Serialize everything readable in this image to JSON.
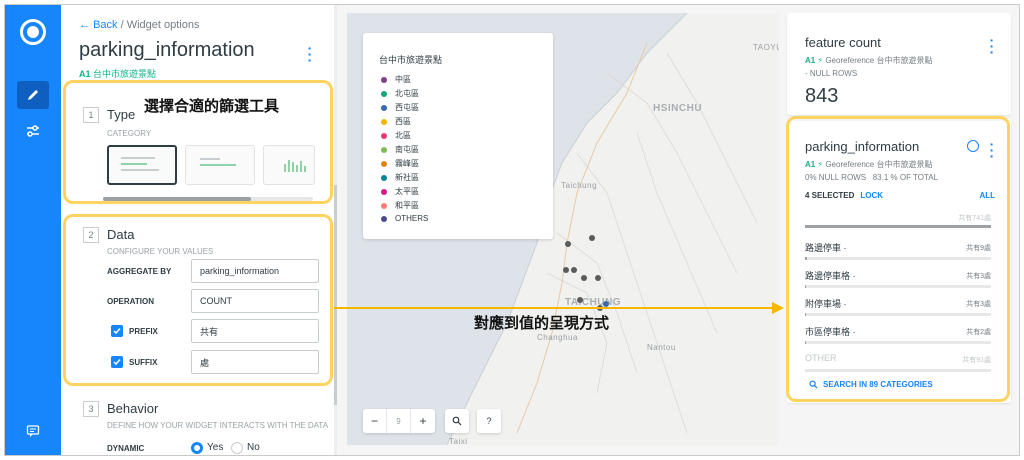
{
  "rail": {
    "logo": "logo-icon",
    "items": [
      "pencil-icon",
      "sliders-icon"
    ],
    "bottom": "chat-icon"
  },
  "editor": {
    "back_label": "Back",
    "breadcrumb_current": "/ Widget options",
    "title": "parking_information",
    "layer_tag": "A1",
    "layer_name": "台中市旅遊景點",
    "type": {
      "num": "1",
      "title": "Type",
      "hint": "CATEGORY"
    },
    "data": {
      "num": "2",
      "title": "Data",
      "hint": "CONFIGURE YOUR VALUES",
      "aggregate_label": "AGGREGATE BY",
      "aggregate_value": "parking_information",
      "operation_label": "OPERATION",
      "operation_value": "COUNT",
      "prefix_label": "PREFIX",
      "prefix_value": "共有",
      "suffix_label": "SUFFIX",
      "suffix_value": "處"
    },
    "behavior": {
      "num": "3",
      "title": "Behavior",
      "hint": "DEFINE HOW YOUR WIDGET INTERACTS WITH THE DATA",
      "dynamic_label": "DYNAMIC",
      "yes_label": "Yes",
      "no_label": "No"
    }
  },
  "map": {
    "labels": [
      "TAOYU",
      "HSINCHU",
      "Taichung",
      "Changhua",
      "Nantou",
      "TAICHUNG",
      "Taixi"
    ],
    "legend": {
      "title": "台中市旅遊景點",
      "items": [
        {
          "label": "中區",
          "color": "#7f3c8d"
        },
        {
          "label": "北屯區",
          "color": "#11a579"
        },
        {
          "label": "西屯區",
          "color": "#3969ac"
        },
        {
          "label": "西區",
          "color": "#f2b701"
        },
        {
          "label": "北區",
          "color": "#e73f74"
        },
        {
          "label": "南屯區",
          "color": "#80ba5a"
        },
        {
          "label": "霧峰區",
          "color": "#e68310"
        },
        {
          "label": "新社區",
          "color": "#008695"
        },
        {
          "label": "太平區",
          "color": "#cf1c90"
        },
        {
          "label": "和平區",
          "color": "#f97b72"
        },
        {
          "label": "OTHERS",
          "color": "#4b4b8f"
        }
      ]
    },
    "zoom_minus": "−",
    "zoom_level": "9",
    "zoom_plus": "+",
    "search_btn": "search-icon",
    "help_btn": "?"
  },
  "widgets": {
    "count": {
      "title": "feature count",
      "tag": "A1",
      "op": "Georeference",
      "source": "台中市旅遊景點",
      "nulls": "- NULL ROWS",
      "value": "843"
    },
    "category": {
      "title": "parking_information",
      "tag": "A1",
      "op": "Georeference",
      "source": "台中市旅遊景點",
      "nulls": "0% NULL ROWS",
      "total": "83.1 % OF TOTAL",
      "selected": "4 SELECTED",
      "lock": "LOCK",
      "all": "ALL",
      "total_note": "共有741處",
      "items": [
        {
          "label": "路邊停車 ·",
          "value": "共有9處",
          "share": 0.012
        },
        {
          "label": "路邊停車格 ·",
          "value": "共有3處",
          "share": 0.004
        },
        {
          "label": "附停車場 ·",
          "value": "共有3處",
          "share": 0.004
        },
        {
          "label": "市區停車格 ·",
          "value": "共有2處",
          "share": 0.003
        }
      ],
      "other_label": "OTHER",
      "other_value": "共有91處",
      "search": "SEARCH IN 89 CATEGORIES"
    }
  },
  "annotations": {
    "type_note": "選擇合適的篩選工具",
    "arrow_note": "對應到值的呈現方式"
  }
}
